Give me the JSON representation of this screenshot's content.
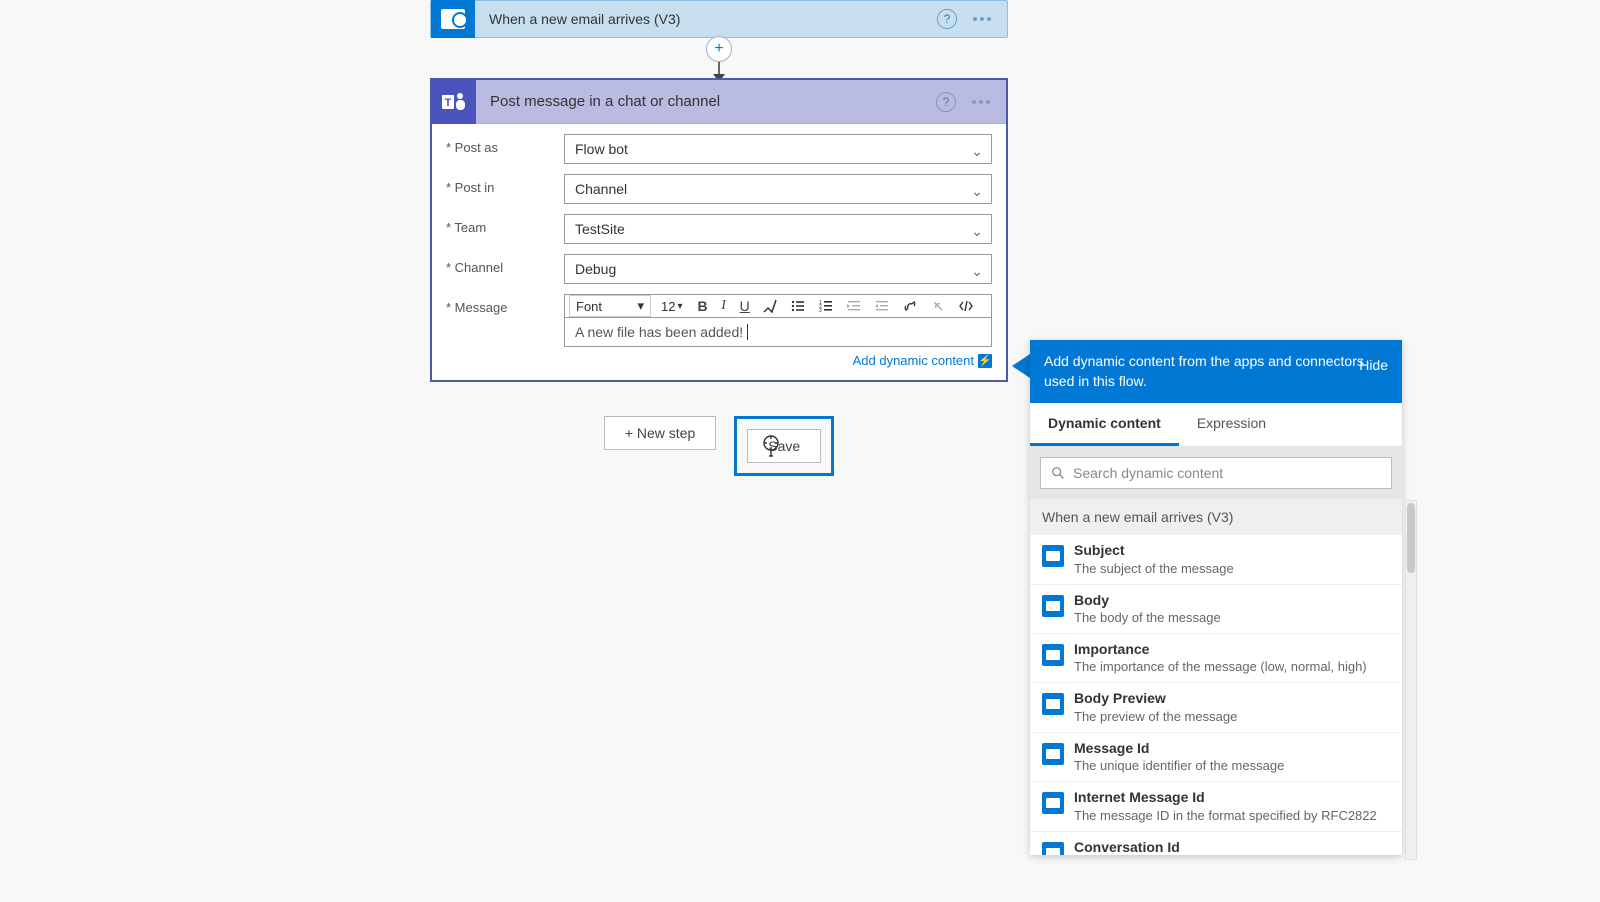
{
  "trigger": {
    "title": "When a new email arrives (V3)"
  },
  "action": {
    "title": "Post message in a chat or channel",
    "fields": {
      "post_as_label": "* Post as",
      "post_as_value": "Flow bot",
      "post_in_label": "* Post in",
      "post_in_value": "Channel",
      "team_label": "* Team",
      "team_value": "TestSite",
      "channel_label": "* Channel",
      "channel_value": "Debug",
      "message_label": "* Message",
      "message_value": "A new file has been added!"
    },
    "toolbar": {
      "font_label": "Font",
      "size_value": "12"
    },
    "add_dynamic_label": "Add dynamic content"
  },
  "buttons": {
    "new_step": "+ New step",
    "save": "Save"
  },
  "dynamic_panel": {
    "header": "Add dynamic content from the apps and connectors used in this flow.",
    "hide": "Hide",
    "tab_dynamic": "Dynamic content",
    "tab_expression": "Expression",
    "search_placeholder": "Search dynamic content",
    "group_title": "When a new email arrives (V3)",
    "items": [
      {
        "name": "Subject",
        "desc": "The subject of the message"
      },
      {
        "name": "Body",
        "desc": "The body of the message"
      },
      {
        "name": "Importance",
        "desc": "The importance of the message (low, normal, high)"
      },
      {
        "name": "Body Preview",
        "desc": "The preview of the message"
      },
      {
        "name": "Message Id",
        "desc": "The unique identifier of the message"
      },
      {
        "name": "Internet Message Id",
        "desc": "The message ID in the format specified by RFC2822"
      },
      {
        "name": "Conversation Id",
        "desc": ""
      }
    ]
  }
}
